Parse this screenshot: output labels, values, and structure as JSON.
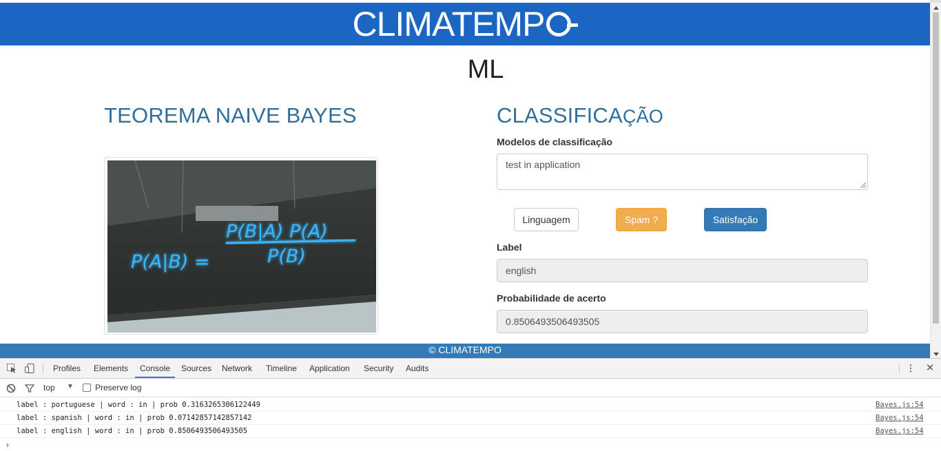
{
  "header": {
    "logo_text": "CLIMATEMP"
  },
  "page_title": "ML",
  "left": {
    "heading": "TEOREMA NAIVE BAYES",
    "image_formula": {
      "lhs": "P(A|B) =",
      "numerator": "P(B|A) P(A)",
      "denominator": "P(B)"
    }
  },
  "right": {
    "heading_part1": "CLASSIFICA",
    "heading_part2": "ÇÃO",
    "models_label": "Modelos de classificação",
    "models_value": "test in application",
    "buttons": {
      "language": "Linguagem",
      "spam": "Spam ?",
      "satisfaction": "Satisfação"
    },
    "label_label": "Label",
    "label_value": "english",
    "prob_label": "Probabilidade de acerto",
    "prob_value": "0.8506493506493505"
  },
  "footer": {
    "text": "© CLIMATEMPO"
  },
  "devtools": {
    "tabs": [
      "Profiles",
      "Elements",
      "Console",
      "Sources",
      "Network",
      "Timeline",
      "Application",
      "Security",
      "Audits"
    ],
    "active_tab": "Console",
    "context": "top",
    "preserve_log": "Preserve log",
    "logs": [
      {
        "message": "label : portuguese | word : in | prob 0.3163265306122449",
        "source": "Bayes.js:54"
      },
      {
        "message": "label : spanish | word : in | prob 0.07142857142857142",
        "source": "Bayes.js:54"
      },
      {
        "message": "label : english | word : in | prob 0.8506493506493505",
        "source": "Bayes.js:54"
      }
    ],
    "prompt": "›"
  },
  "colors": {
    "header_blue": "#1a66c2",
    "heading_blue": "#2e6f9e",
    "footer_blue": "#337ab7",
    "warning": "#f0ad4e",
    "primary": "#337ab7"
  }
}
